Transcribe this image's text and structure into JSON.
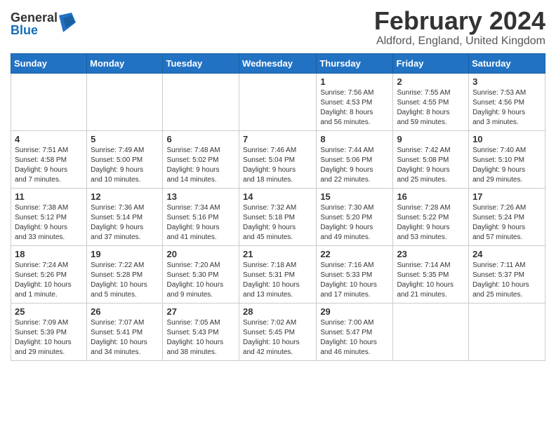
{
  "logo": {
    "general": "General",
    "blue": "Blue"
  },
  "header": {
    "month": "February 2024",
    "location": "Aldford, England, United Kingdom"
  },
  "weekdays": [
    "Sunday",
    "Monday",
    "Tuesday",
    "Wednesday",
    "Thursday",
    "Friday",
    "Saturday"
  ],
  "weeks": [
    [
      {
        "day": "",
        "info": ""
      },
      {
        "day": "",
        "info": ""
      },
      {
        "day": "",
        "info": ""
      },
      {
        "day": "",
        "info": ""
      },
      {
        "day": "1",
        "info": "Sunrise: 7:56 AM\nSunset: 4:53 PM\nDaylight: 8 hours\nand 56 minutes."
      },
      {
        "day": "2",
        "info": "Sunrise: 7:55 AM\nSunset: 4:55 PM\nDaylight: 8 hours\nand 59 minutes."
      },
      {
        "day": "3",
        "info": "Sunrise: 7:53 AM\nSunset: 4:56 PM\nDaylight: 9 hours\nand 3 minutes."
      }
    ],
    [
      {
        "day": "4",
        "info": "Sunrise: 7:51 AM\nSunset: 4:58 PM\nDaylight: 9 hours\nand 7 minutes."
      },
      {
        "day": "5",
        "info": "Sunrise: 7:49 AM\nSunset: 5:00 PM\nDaylight: 9 hours\nand 10 minutes."
      },
      {
        "day": "6",
        "info": "Sunrise: 7:48 AM\nSunset: 5:02 PM\nDaylight: 9 hours\nand 14 minutes."
      },
      {
        "day": "7",
        "info": "Sunrise: 7:46 AM\nSunset: 5:04 PM\nDaylight: 9 hours\nand 18 minutes."
      },
      {
        "day": "8",
        "info": "Sunrise: 7:44 AM\nSunset: 5:06 PM\nDaylight: 9 hours\nand 22 minutes."
      },
      {
        "day": "9",
        "info": "Sunrise: 7:42 AM\nSunset: 5:08 PM\nDaylight: 9 hours\nand 25 minutes."
      },
      {
        "day": "10",
        "info": "Sunrise: 7:40 AM\nSunset: 5:10 PM\nDaylight: 9 hours\nand 29 minutes."
      }
    ],
    [
      {
        "day": "11",
        "info": "Sunrise: 7:38 AM\nSunset: 5:12 PM\nDaylight: 9 hours\nand 33 minutes."
      },
      {
        "day": "12",
        "info": "Sunrise: 7:36 AM\nSunset: 5:14 PM\nDaylight: 9 hours\nand 37 minutes."
      },
      {
        "day": "13",
        "info": "Sunrise: 7:34 AM\nSunset: 5:16 PM\nDaylight: 9 hours\nand 41 minutes."
      },
      {
        "day": "14",
        "info": "Sunrise: 7:32 AM\nSunset: 5:18 PM\nDaylight: 9 hours\nand 45 minutes."
      },
      {
        "day": "15",
        "info": "Sunrise: 7:30 AM\nSunset: 5:20 PM\nDaylight: 9 hours\nand 49 minutes."
      },
      {
        "day": "16",
        "info": "Sunrise: 7:28 AM\nSunset: 5:22 PM\nDaylight: 9 hours\nand 53 minutes."
      },
      {
        "day": "17",
        "info": "Sunrise: 7:26 AM\nSunset: 5:24 PM\nDaylight: 9 hours\nand 57 minutes."
      }
    ],
    [
      {
        "day": "18",
        "info": "Sunrise: 7:24 AM\nSunset: 5:26 PM\nDaylight: 10 hours\nand 1 minute."
      },
      {
        "day": "19",
        "info": "Sunrise: 7:22 AM\nSunset: 5:28 PM\nDaylight: 10 hours\nand 5 minutes."
      },
      {
        "day": "20",
        "info": "Sunrise: 7:20 AM\nSunset: 5:30 PM\nDaylight: 10 hours\nand 9 minutes."
      },
      {
        "day": "21",
        "info": "Sunrise: 7:18 AM\nSunset: 5:31 PM\nDaylight: 10 hours\nand 13 minutes."
      },
      {
        "day": "22",
        "info": "Sunrise: 7:16 AM\nSunset: 5:33 PM\nDaylight: 10 hours\nand 17 minutes."
      },
      {
        "day": "23",
        "info": "Sunrise: 7:14 AM\nSunset: 5:35 PM\nDaylight: 10 hours\nand 21 minutes."
      },
      {
        "day": "24",
        "info": "Sunrise: 7:11 AM\nSunset: 5:37 PM\nDaylight: 10 hours\nand 25 minutes."
      }
    ],
    [
      {
        "day": "25",
        "info": "Sunrise: 7:09 AM\nSunset: 5:39 PM\nDaylight: 10 hours\nand 29 minutes."
      },
      {
        "day": "26",
        "info": "Sunrise: 7:07 AM\nSunset: 5:41 PM\nDaylight: 10 hours\nand 34 minutes."
      },
      {
        "day": "27",
        "info": "Sunrise: 7:05 AM\nSunset: 5:43 PM\nDaylight: 10 hours\nand 38 minutes."
      },
      {
        "day": "28",
        "info": "Sunrise: 7:02 AM\nSunset: 5:45 PM\nDaylight: 10 hours\nand 42 minutes."
      },
      {
        "day": "29",
        "info": "Sunrise: 7:00 AM\nSunset: 5:47 PM\nDaylight: 10 hours\nand 46 minutes."
      },
      {
        "day": "",
        "info": ""
      },
      {
        "day": "",
        "info": ""
      }
    ]
  ]
}
